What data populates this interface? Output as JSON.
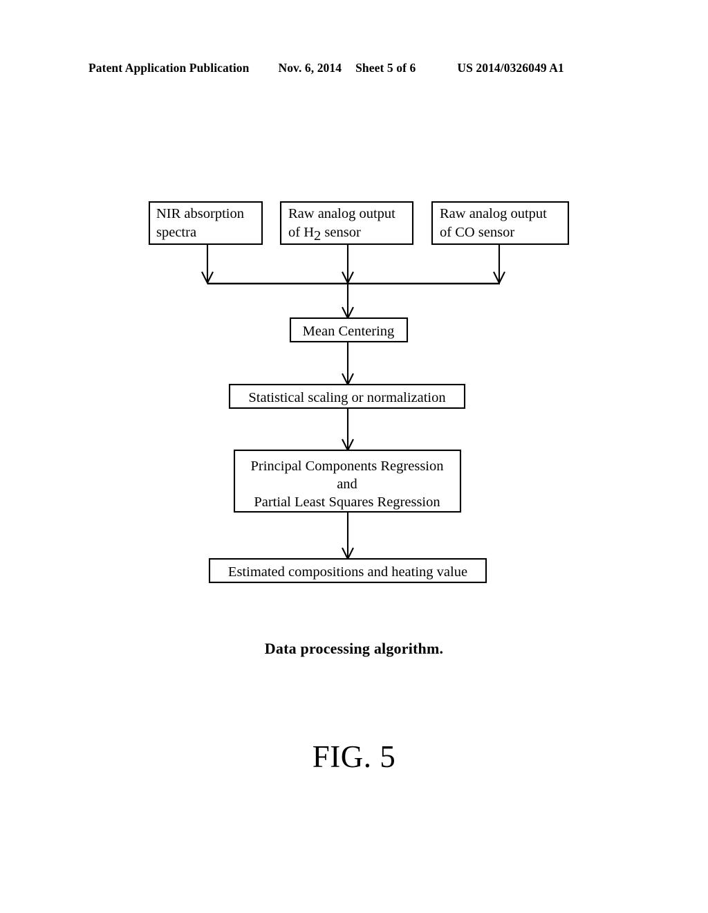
{
  "header": {
    "publication": "Patent Application Publication",
    "date": "Nov. 6, 2014",
    "sheet": "Sheet 5 of 6",
    "patent_number": "US 2014/0326049 A1"
  },
  "figure": {
    "caption": "Data processing algorithm.",
    "label": "FIG. 5",
    "nodes": {
      "input_1_line_1": "NIR absorption",
      "input_1_line_2": "spectra",
      "input_2_line_1": "Raw analog output",
      "input_2_line_2_pre": "of H",
      "input_2_line_2_sub": "2",
      "input_2_line_2_post": " sensor",
      "input_3_line_1": "Raw analog output",
      "input_3_line_2": "of CO sensor",
      "mean_centering": "Mean Centering",
      "scaling": "Statistical scaling or normalization",
      "regression_line_1": "Principal Components Regression",
      "regression_line_2": "and",
      "regression_line_3": "Partial Least Squares Regression",
      "output": "Estimated compositions and heating value"
    }
  },
  "colors": {
    "ink": "#000000",
    "paper": "#ffffff"
  }
}
